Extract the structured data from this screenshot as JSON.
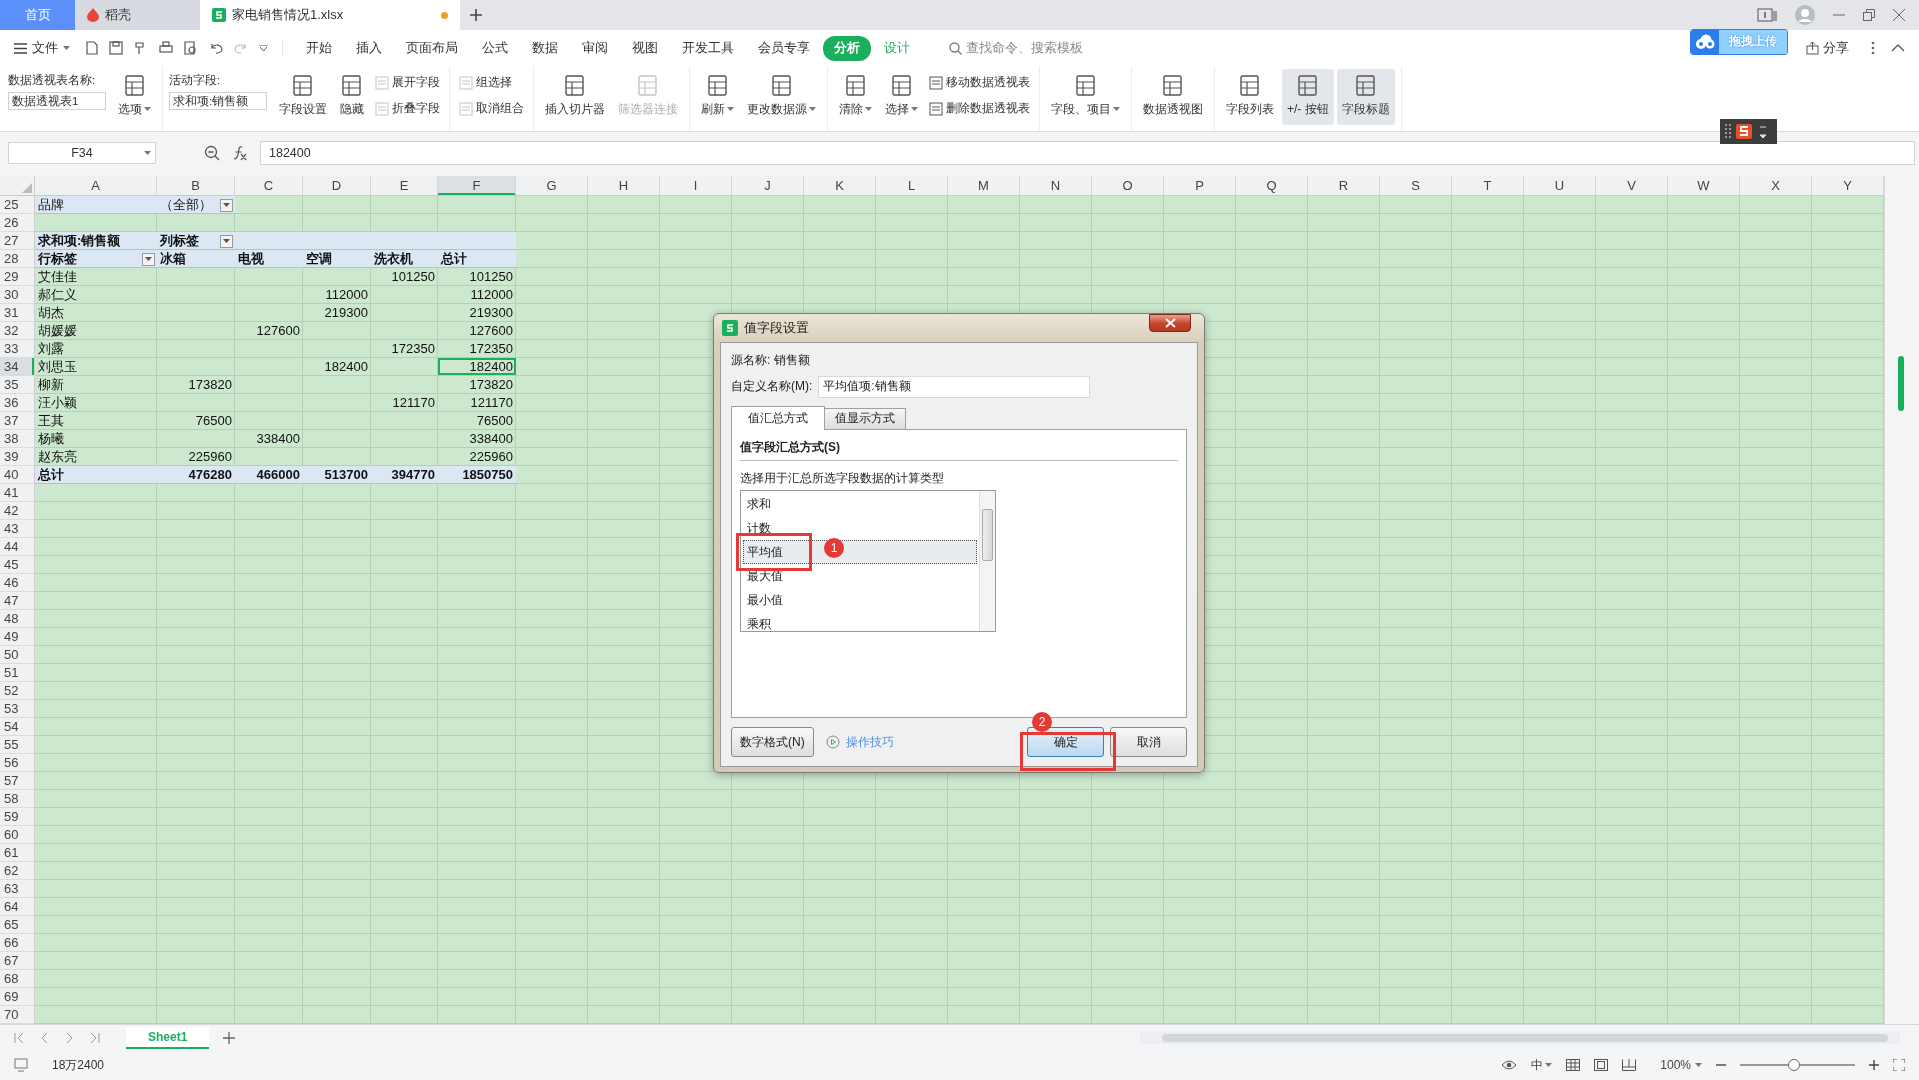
{
  "window_tabs": [
    {
      "label": "首页",
      "kind": "home",
      "selected": false,
      "unsaved": false
    },
    {
      "label": "稻壳",
      "kind": "docer",
      "selected": false,
      "unsaved": false
    },
    {
      "label": "家电销售情况1.xlsx",
      "kind": "sheet",
      "selected": true,
      "unsaved": true
    }
  ],
  "menu": {
    "file": "文件",
    "items": [
      {
        "label": "开始",
        "kind": "normal",
        "selected": false
      },
      {
        "label": "插入",
        "kind": "normal",
        "selected": false
      },
      {
        "label": "页面布局",
        "kind": "normal",
        "selected": false
      },
      {
        "label": "公式",
        "kind": "normal",
        "selected": false
      },
      {
        "label": "数据",
        "kind": "normal",
        "selected": false
      },
      {
        "label": "审阅",
        "kind": "normal",
        "selected": false
      },
      {
        "label": "视图",
        "kind": "normal",
        "selected": false
      },
      {
        "label": "开发工具",
        "kind": "normal",
        "selected": false
      },
      {
        "label": "会员专享",
        "kind": "normal",
        "selected": false
      },
      {
        "label": "分析",
        "kind": "context",
        "selected": true
      },
      {
        "label": "设计",
        "kind": "context",
        "selected": false
      }
    ],
    "search_placeholder": "查找命令、搜索模板",
    "share": "分享"
  },
  "ribbon": {
    "groups": [
      {
        "items": [
          {
            "kind": "field",
            "label": "数据透视表名称:",
            "value": "数据透视表1"
          },
          {
            "kind": "large",
            "label": "选项",
            "dropdown": true,
            "disabled": false,
            "pressed": false
          }
        ]
      },
      {
        "items": [
          {
            "kind": "field",
            "label": "活动字段:",
            "value": "求和项:销售额"
          },
          {
            "kind": "large",
            "label": "字段设置",
            "dropdown": false,
            "disabled": false,
            "pressed": false
          },
          {
            "kind": "large",
            "label": "隐藏",
            "dropdown": false,
            "disabled": false,
            "pressed": false
          },
          {
            "kind": "stack",
            "buttons": [
              {
                "label": "展开字段",
                "disabled": true
              },
              {
                "label": "折叠字段",
                "disabled": true
              }
            ]
          }
        ]
      },
      {
        "items": [
          {
            "kind": "stack",
            "buttons": [
              {
                "label": "组选择",
                "disabled": true
              },
              {
                "label": "取消组合",
                "disabled": true
              }
            ]
          }
        ]
      },
      {
        "items": [
          {
            "kind": "large",
            "label": "插入切片器",
            "dropdown": false,
            "disabled": false,
            "pressed": false
          },
          {
            "kind": "large",
            "label": "筛选器连接",
            "dropdown": false,
            "disabled": true,
            "pressed": false
          }
        ]
      },
      {
        "items": [
          {
            "kind": "large",
            "label": "刷新",
            "dropdown": true,
            "disabled": false,
            "pressed": false
          },
          {
            "kind": "large",
            "label": "更改数据源",
            "dropdown": true,
            "disabled": false,
            "pressed": false
          }
        ]
      },
      {
        "items": [
          {
            "kind": "large",
            "label": "清除",
            "dropdown": true,
            "disabled": false,
            "pressed": false
          },
          {
            "kind": "large",
            "label": "选择",
            "dropdown": true,
            "disabled": false,
            "pressed": false
          },
          {
            "kind": "stack",
            "buttons": [
              {
                "label": "移动数据透视表",
                "disabled": false
              },
              {
                "label": "删除数据透视表",
                "disabled": false
              }
            ]
          }
        ]
      },
      {
        "items": [
          {
            "kind": "large",
            "label": "字段、项目",
            "dropdown": true,
            "disabled": false,
            "pressed": false
          }
        ]
      },
      {
        "items": [
          {
            "kind": "large",
            "label": "数据透视图",
            "dropdown": false,
            "disabled": false,
            "pressed": false
          }
        ]
      },
      {
        "items": [
          {
            "kind": "large",
            "label": "字段列表",
            "dropdown": false,
            "disabled": false,
            "pressed": false
          },
          {
            "kind": "large",
            "label": "+/- 按钮",
            "dropdown": false,
            "disabled": false,
            "pressed": true
          },
          {
            "kind": "large",
            "label": "字段标题",
            "dropdown": false,
            "disabled": false,
            "pressed": true
          }
        ]
      }
    ]
  },
  "sheet": {
    "name_box": "F34",
    "formula": "182400",
    "columns": [
      {
        "label": "A",
        "selected": false
      },
      {
        "label": "B",
        "selected": false
      },
      {
        "label": "C",
        "selected": false
      },
      {
        "label": "D",
        "selected": false
      },
      {
        "label": "E",
        "selected": false
      },
      {
        "label": "F",
        "selected": true
      },
      {
        "label": "G",
        "selected": false
      },
      {
        "label": "H",
        "selected": false
      },
      {
        "label": "I",
        "selected": false
      },
      {
        "label": "J",
        "selected": false
      },
      {
        "label": "K",
        "selected": false
      },
      {
        "label": "L",
        "selected": false
      },
      {
        "label": "M",
        "selected": false
      },
      {
        "label": "N",
        "selected": false
      },
      {
        "label": "O",
        "selected": false
      },
      {
        "label": "P",
        "selected": false
      },
      {
        "label": "Q",
        "selected": false
      },
      {
        "label": "R",
        "selected": false
      },
      {
        "label": "S",
        "selected": false
      },
      {
        "label": "T",
        "selected": false
      },
      {
        "label": "U",
        "selected": false
      },
      {
        "label": "V",
        "selected": false
      },
      {
        "label": "W",
        "selected": false
      },
      {
        "label": "X",
        "selected": false
      },
      {
        "label": "Y",
        "selected": false
      }
    ],
    "rows": [
      {
        "label": "25",
        "kind": "filter",
        "selected": false,
        "cells": [
          {
            "text": "品牌",
            "dropdown": false
          },
          {
            "text": "（全部）",
            "dropdown": true
          }
        ]
      },
      {
        "label": "26",
        "kind": "blank",
        "selected": false,
        "cells": []
      },
      {
        "label": "27",
        "kind": "title",
        "selected": false,
        "cells": [
          {
            "text": "求和项:销售额",
            "dropdown": false
          },
          {
            "text": "列标签",
            "dropdown": true
          }
        ]
      },
      {
        "label": "28",
        "kind": "header",
        "selected": false,
        "cells": [
          {
            "text": "行标签",
            "dropdown": true
          },
          {
            "text": "冰箱",
            "dropdown": false
          },
          {
            "text": "电视",
            "dropdown": false
          },
          {
            "text": "空调",
            "dropdown": false
          },
          {
            "text": "洗衣机",
            "dropdown": false
          },
          {
            "text": "总计",
            "dropdown": false
          }
        ]
      },
      {
        "label": "29",
        "kind": "data",
        "selected": false,
        "cells": [
          "艾佳佳",
          null,
          null,
          null,
          "101250",
          "101250"
        ]
      },
      {
        "label": "30",
        "kind": "data",
        "selected": false,
        "cells": [
          "郝仁义",
          null,
          null,
          "112000",
          null,
          "112000"
        ]
      },
      {
        "label": "31",
        "kind": "data",
        "selected": false,
        "cells": [
          "胡杰",
          null,
          null,
          "219300",
          null,
          "219300"
        ]
      },
      {
        "label": "32",
        "kind": "data",
        "selected": false,
        "cells": [
          "胡媛媛",
          null,
          "127600",
          null,
          null,
          "127600"
        ]
      },
      {
        "label": "33",
        "kind": "data",
        "selected": false,
        "cells": [
          "刘露",
          null,
          null,
          null,
          "172350",
          "172350"
        ]
      },
      {
        "label": "34",
        "kind": "data",
        "selected": true,
        "cells": [
          "刘思玉",
          null,
          null,
          "182400",
          null,
          "182400"
        ]
      },
      {
        "label": "35",
        "kind": "data",
        "selected": false,
        "cells": [
          "柳新",
          "173820",
          null,
          null,
          null,
          "173820"
        ]
      },
      {
        "label": "36",
        "kind": "data",
        "selected": false,
        "cells": [
          "汪小颖",
          null,
          null,
          null,
          "121170",
          "121170"
        ]
      },
      {
        "label": "37",
        "kind": "data",
        "selected": false,
        "cells": [
          "王其",
          "76500",
          null,
          null,
          null,
          "76500"
        ]
      },
      {
        "label": "38",
        "kind": "data",
        "selected": false,
        "cells": [
          "杨曦",
          null,
          "338400",
          null,
          null,
          "338400"
        ]
      },
      {
        "label": "39",
        "kind": "data",
        "selected": false,
        "cells": [
          "赵东亮",
          "225960",
          null,
          null,
          null,
          "225960"
        ]
      },
      {
        "label": "40",
        "kind": "total",
        "selected": false,
        "cells": [
          "总计",
          "476280",
          "466000",
          "513700",
          "394770",
          "1850750"
        ]
      },
      {
        "label": "41",
        "kind": "empty",
        "selected": false,
        "cells": []
      },
      {
        "label": "42",
        "kind": "empty",
        "selected": false,
        "cells": []
      },
      {
        "label": "43",
        "kind": "empty",
        "selected": false,
        "cells": []
      },
      {
        "label": "44",
        "kind": "empty",
        "selected": false,
        "cells": []
      },
      {
        "label": "45",
        "kind": "empty",
        "selected": false,
        "cells": []
      },
      {
        "label": "46",
        "kind": "empty",
        "selected": false,
        "cells": []
      },
      {
        "label": "47",
        "kind": "empty",
        "selected": false,
        "cells": []
      },
      {
        "label": "48",
        "kind": "empty",
        "selected": false,
        "cells": []
      },
      {
        "label": "49",
        "kind": "empty",
        "selected": false,
        "cells": []
      },
      {
        "label": "50",
        "kind": "empty",
        "selected": false,
        "cells": []
      },
      {
        "label": "51",
        "kind": "empty",
        "selected": false,
        "cells": []
      },
      {
        "label": "52",
        "kind": "empty",
        "selected": false,
        "cells": []
      },
      {
        "label": "53",
        "kind": "empty",
        "selected": false,
        "cells": []
      },
      {
        "label": "54",
        "kind": "empty",
        "selected": false,
        "cells": []
      },
      {
        "label": "55",
        "kind": "empty",
        "selected": false,
        "cells": []
      },
      {
        "label": "56",
        "kind": "empty",
        "selected": false,
        "cells": []
      },
      {
        "label": "57",
        "kind": "empty",
        "selected": false,
        "cells": []
      },
      {
        "label": "58",
        "kind": "empty",
        "selected": false,
        "cells": []
      },
      {
        "label": "59",
        "kind": "empty",
        "selected": false,
        "cells": []
      },
      {
        "label": "60",
        "kind": "empty",
        "selected": false,
        "cells": []
      },
      {
        "label": "61",
        "kind": "empty",
        "selected": false,
        "cells": []
      },
      {
        "label": "62",
        "kind": "empty",
        "selected": false,
        "cells": []
      },
      {
        "label": "63",
        "kind": "empty",
        "selected": false,
        "cells": []
      },
      {
        "label": "64",
        "kind": "empty",
        "selected": false,
        "cells": []
      },
      {
        "label": "65",
        "kind": "empty",
        "selected": false,
        "cells": []
      },
      {
        "label": "66",
        "kind": "empty",
        "selected": false,
        "cells": []
      },
      {
        "label": "67",
        "kind": "empty",
        "selected": false,
        "cells": []
      },
      {
        "label": "68",
        "kind": "empty",
        "selected": false,
        "cells": []
      },
      {
        "label": "69",
        "kind": "empty",
        "selected": false,
        "cells": []
      },
      {
        "label": "70",
        "kind": "empty",
        "selected": false,
        "cells": []
      }
    ]
  },
  "footer": {
    "sheets": [
      {
        "label": "Sheet1",
        "selected": true
      }
    ],
    "status": "18万2400",
    "input_mode": "中",
    "zoom": "100%",
    "zoom_slider": {
      "level": 0.47
    }
  },
  "dialog": {
    "title": "值字段设置",
    "source": "源名称: 销售额",
    "custom_name_label": "自定义名称(M):",
    "custom_name": "平均值项:销售额",
    "tabs": [
      {
        "label": "值汇总方式",
        "selected": true
      },
      {
        "label": "值显示方式",
        "selected": false
      }
    ],
    "section_title": "值字段汇总方式(S)",
    "hint": "选择用于汇总所选字段数据的计算类型",
    "options": [
      {
        "label": "求和",
        "selected": false
      },
      {
        "label": "计数",
        "selected": false
      },
      {
        "label": "平均值",
        "selected": true
      },
      {
        "label": "最大值",
        "selected": false
      },
      {
        "label": "最小值",
        "selected": false
      },
      {
        "label": "乘积",
        "selected": false
      }
    ],
    "number_format": "数字格式(N)",
    "tips": "操作技巧",
    "ok": "确定",
    "cancel": "取消",
    "callouts": [
      {
        "label": "1"
      },
      {
        "label": "2"
      }
    ]
  },
  "upload_tip": "拖拽上传"
}
